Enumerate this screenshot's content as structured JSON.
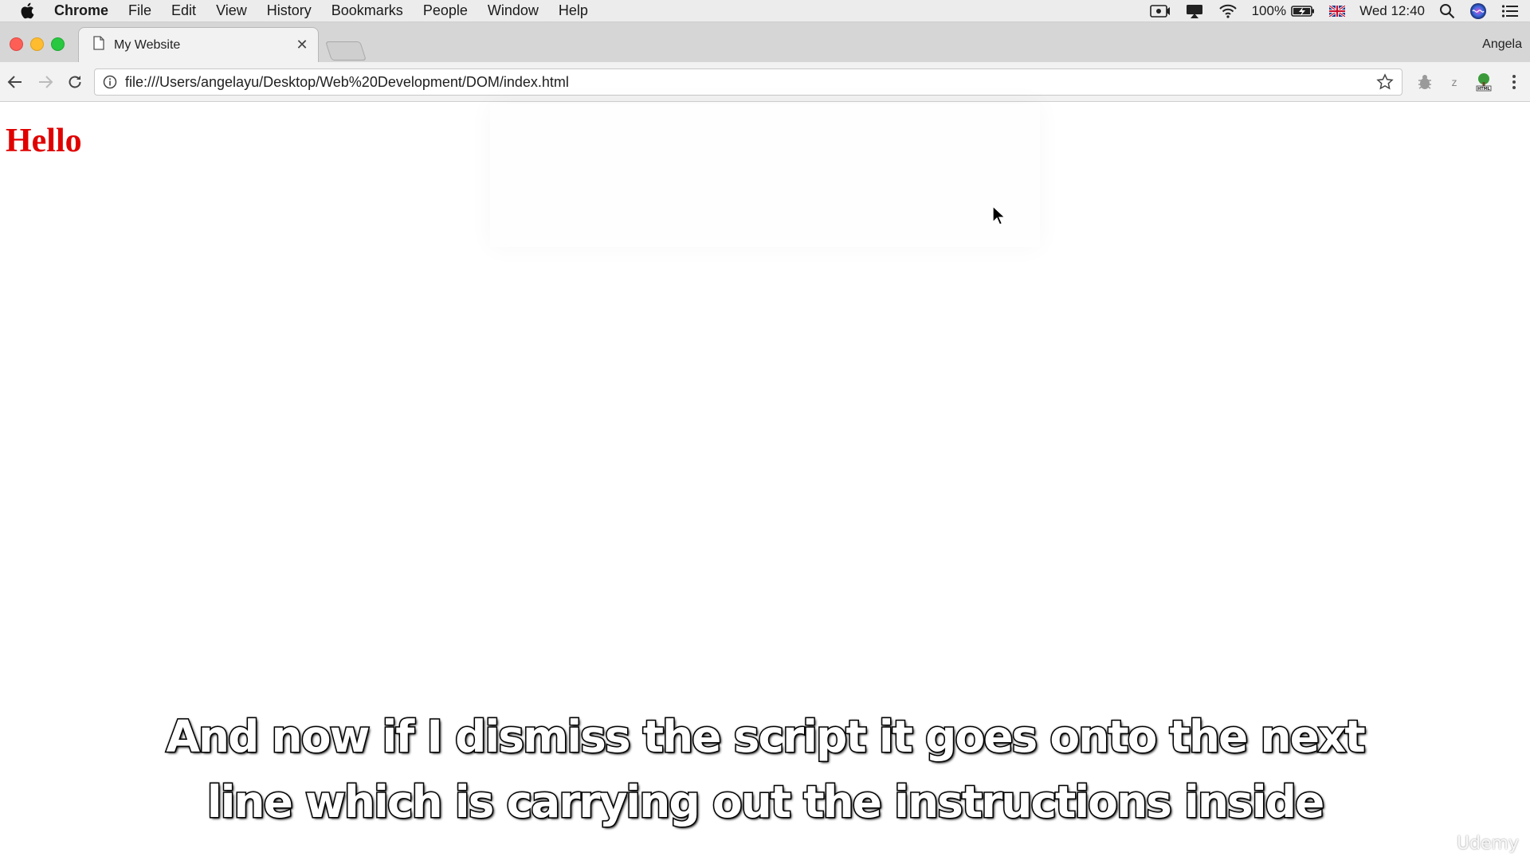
{
  "menubar": {
    "app_name": "Chrome",
    "items": [
      "File",
      "Edit",
      "View",
      "History",
      "Bookmarks",
      "People",
      "Window",
      "Help"
    ],
    "battery_percent": "100%",
    "clock": "Wed 12:40"
  },
  "browser": {
    "tab_title": "My Website",
    "profile_name": "Angela",
    "url": "file:///Users/angelayu/Desktop/Web%20Development/DOM/index.html"
  },
  "page": {
    "heading": "Hello",
    "heading_color": "#e00000"
  },
  "subtitles": {
    "line1": "And now if I dismiss the script it goes onto the next",
    "line2": "line which is carrying out the instructions inside"
  },
  "watermark": "Udemy"
}
